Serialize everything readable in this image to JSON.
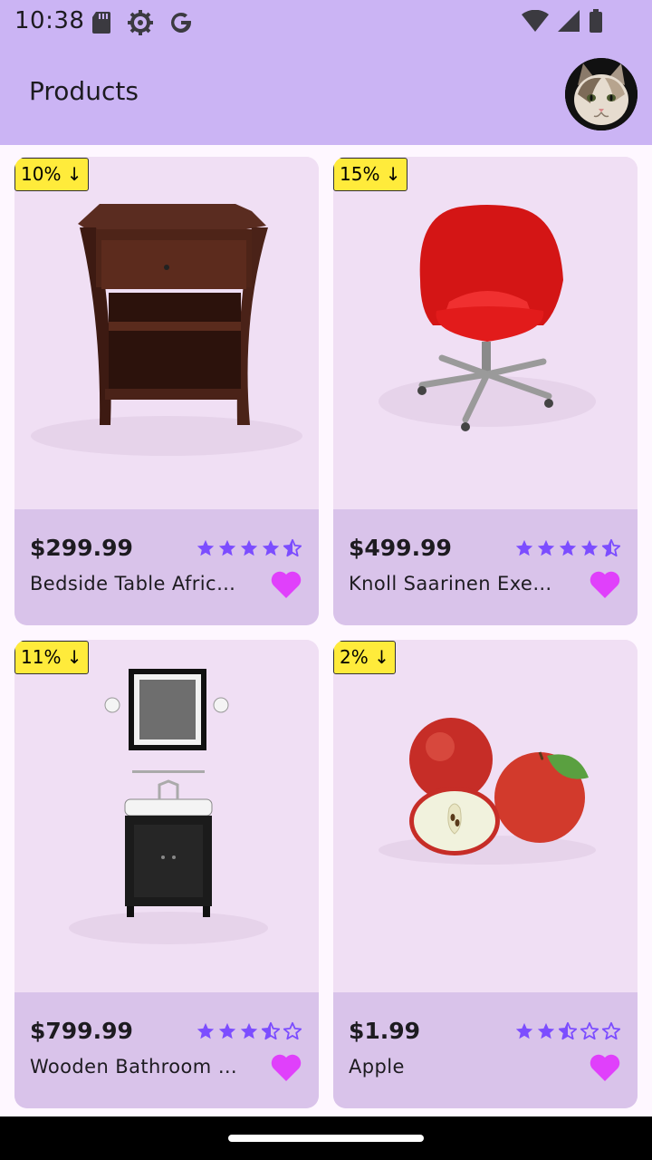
{
  "status_bar": {
    "time": "10:38",
    "left_icons": [
      "sd-card-icon",
      "settings-icon",
      "google-icon"
    ],
    "right_icons": [
      "wifi-icon",
      "signal-icon",
      "battery-icon"
    ]
  },
  "app_bar": {
    "title": "Products",
    "avatar": "cat-avatar"
  },
  "colors": {
    "app_bar": "#cbb4f4",
    "card_bg": "#f0dff4",
    "card_footer": "#d9c3ea",
    "star": "#7c4dff",
    "heart": "#e040fb",
    "badge": "#ffeb3b"
  },
  "products": [
    {
      "discount": "10% ↓",
      "price": "$299.99",
      "name": "Bedside Table African Cherry",
      "rating": 4.5,
      "favorite": true,
      "image": "bedside-table"
    },
    {
      "discount": "15% ↓",
      "price": "$499.99",
      "name": "Knoll Saarinen Executive Conference Chair",
      "rating": 4.5,
      "favorite": true,
      "image": "red-chair"
    },
    {
      "discount": "11% ↓",
      "price": "$799.99",
      "name": "Wooden Bathroom Sink With Mirror",
      "rating": 3.5,
      "favorite": true,
      "image": "bathroom-sink"
    },
    {
      "discount": "2% ↓",
      "price": "$1.99",
      "name": "Apple",
      "rating": 2.5,
      "favorite": true,
      "image": "apples"
    }
  ]
}
